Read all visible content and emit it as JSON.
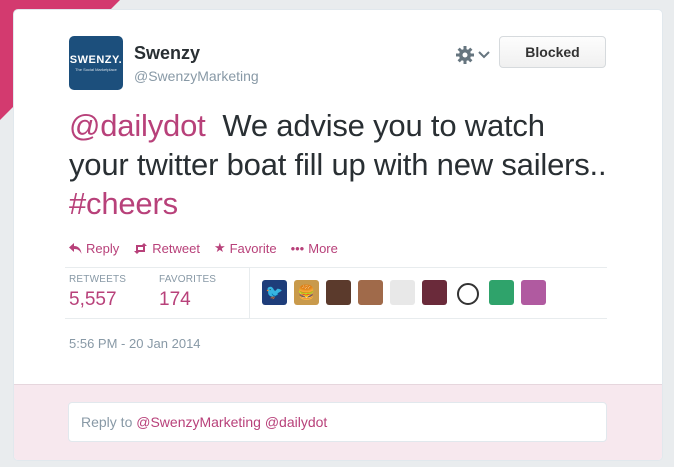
{
  "profile": {
    "name": "Swenzy",
    "handle": "@SwenzyMarketing",
    "avatar_brand": "SWENZY.",
    "avatar_tagline": "The Social Marketplace"
  },
  "header": {
    "gear_icon": "gear-icon",
    "blocked_label": "Blocked"
  },
  "tweet": {
    "mention": "@dailydot",
    "text": "We advise you to watch your twitter boat fill up with new sailers..",
    "hashtag": "#cheers"
  },
  "actions": {
    "reply": "Reply",
    "retweet": "Retweet",
    "favorite": "Favorite",
    "more": "More"
  },
  "stats": {
    "retweets_label": "RETWEETS",
    "retweets_value": "5,557",
    "favorites_label": "FAVORITES",
    "favorites_value": "174"
  },
  "faces": [
    {
      "color": "#1e3d7a",
      "symbol": "🐦"
    },
    {
      "color": "#c99a4b",
      "symbol": "🍔"
    },
    {
      "color": "#5b3a2c",
      "symbol": ""
    },
    {
      "color": "#a06a4a",
      "symbol": ""
    },
    {
      "color": "#e8e8e8",
      "symbol": ""
    },
    {
      "color": "#6a2a3a",
      "symbol": ""
    },
    {
      "color": "#ffffff",
      "symbol": ""
    },
    {
      "color": "#2fa36b",
      "symbol": ""
    },
    {
      "color": "#b05aa0",
      "symbol": ""
    }
  ],
  "timestamp": "5:56 PM - 20 Jan 2014",
  "reply": {
    "prefix": "Reply to",
    "mention1": "@SwenzyMarketing",
    "mention2": "@dailydot"
  },
  "colors": {
    "accent": "#b8417a",
    "corner": "#d33a6f",
    "reply_bg": "#f7e8ee",
    "avatar_bg": "#1c4f7c"
  }
}
